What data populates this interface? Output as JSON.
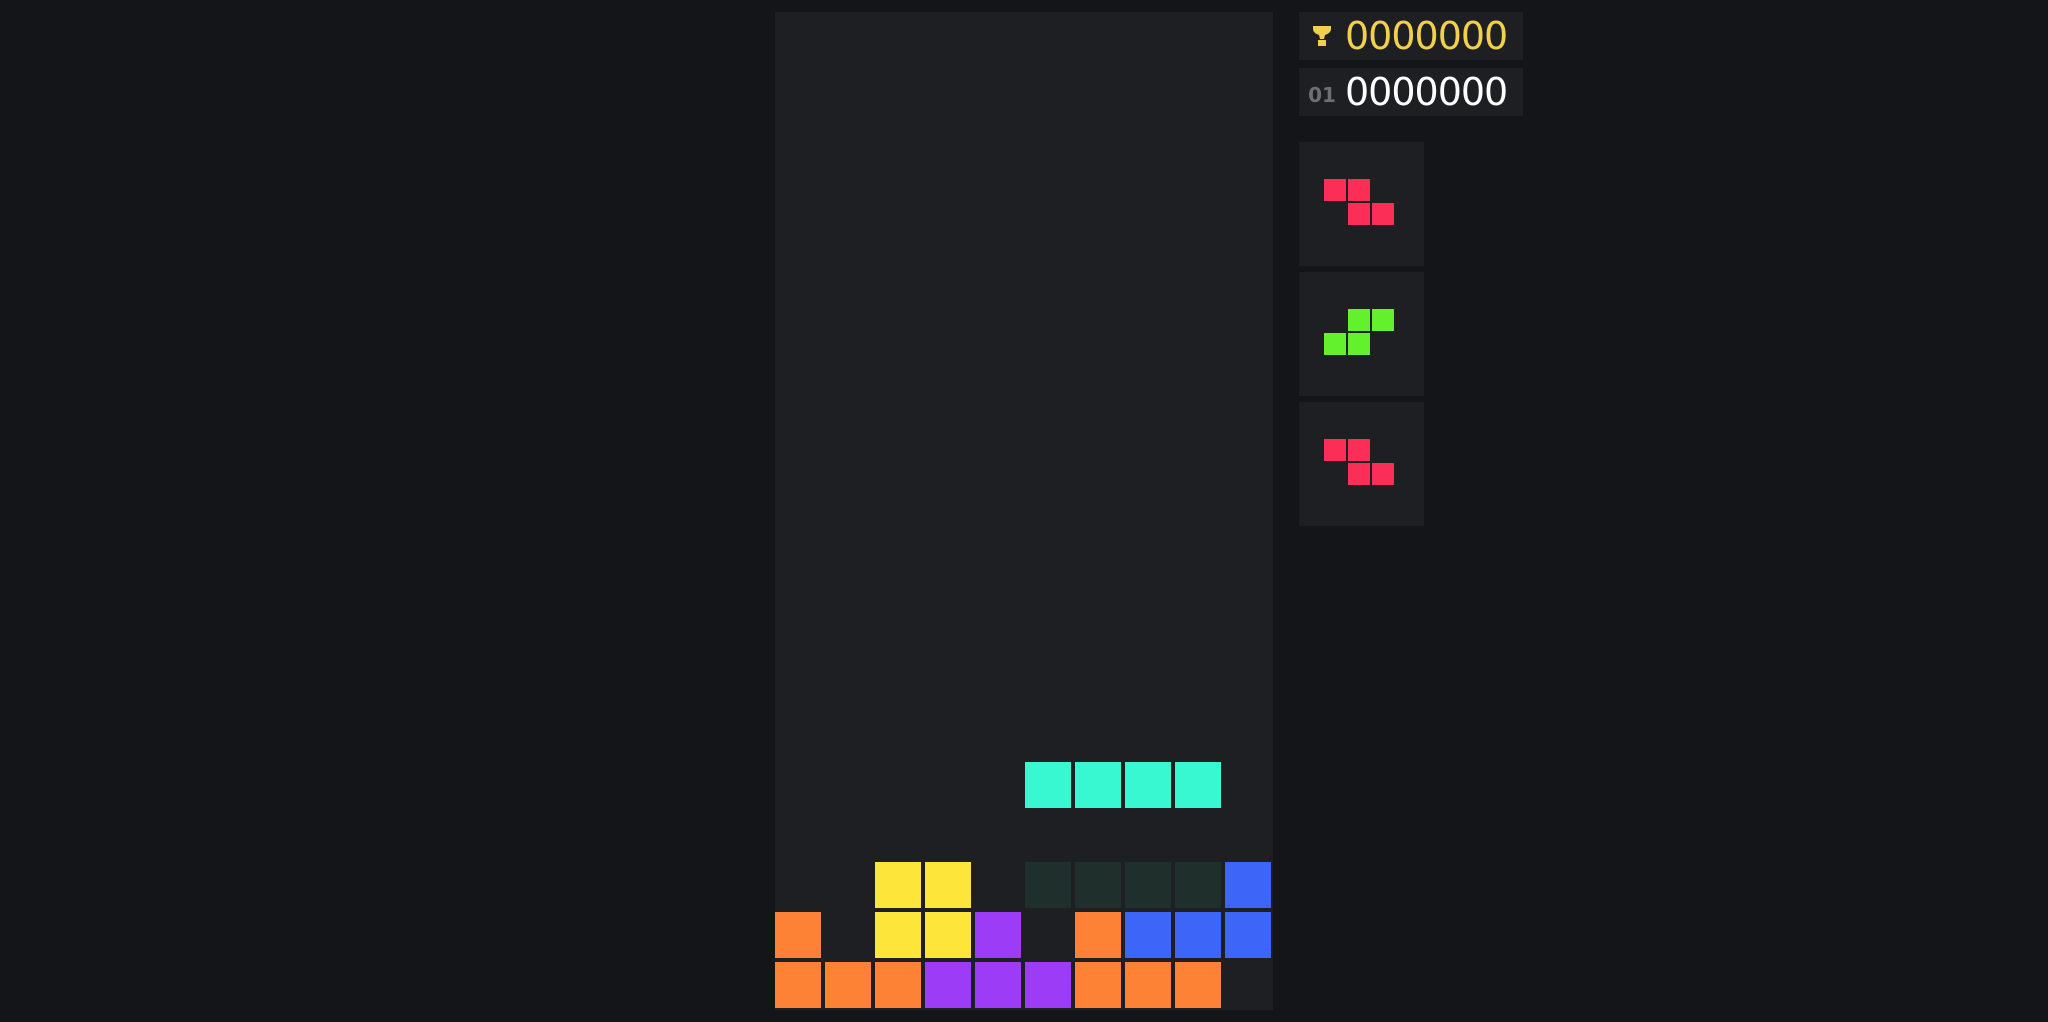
{
  "scores": {
    "best": "0000000",
    "current": "0000000",
    "level": "01"
  },
  "icons": {
    "best": "trophy-icon"
  },
  "colors": {
    "background": "#131519",
    "board": "#1d1f23",
    "ghost": "#1f2f2c",
    "best_score": "#f3d04c",
    "current_score": "#ffffff",
    "level_label": "#6c6f75",
    "I": "#38f8d1",
    "O": "#fde53a",
    "T": "#9d3cf7",
    "L": "#fd8236",
    "J": "#3d66f8",
    "S": "#63f12d",
    "Z": "#fa2e56"
  },
  "board": {
    "columns": 10,
    "rows": 20,
    "locked": [
      {
        "row": 17,
        "col": 2,
        "piece": "O"
      },
      {
        "row": 17,
        "col": 3,
        "piece": "O"
      },
      {
        "row": 17,
        "col": 9,
        "piece": "J"
      },
      {
        "row": 18,
        "col": 0,
        "piece": "L"
      },
      {
        "row": 18,
        "col": 2,
        "piece": "O"
      },
      {
        "row": 18,
        "col": 3,
        "piece": "O"
      },
      {
        "row": 18,
        "col": 4,
        "piece": "T"
      },
      {
        "row": 18,
        "col": 6,
        "piece": "L"
      },
      {
        "row": 18,
        "col": 7,
        "piece": "J"
      },
      {
        "row": 18,
        "col": 8,
        "piece": "J"
      },
      {
        "row": 18,
        "col": 9,
        "piece": "J"
      },
      {
        "row": 19,
        "col": 0,
        "piece": "L"
      },
      {
        "row": 19,
        "col": 1,
        "piece": "L"
      },
      {
        "row": 19,
        "col": 2,
        "piece": "L"
      },
      {
        "row": 19,
        "col": 3,
        "piece": "T"
      },
      {
        "row": 19,
        "col": 4,
        "piece": "T"
      },
      {
        "row": 19,
        "col": 5,
        "piece": "T"
      },
      {
        "row": 19,
        "col": 6,
        "piece": "L"
      },
      {
        "row": 19,
        "col": 7,
        "piece": "L"
      },
      {
        "row": 19,
        "col": 8,
        "piece": "L"
      }
    ],
    "active": {
      "piece": "I",
      "cells": [
        {
          "row": 15,
          "col": 5
        },
        {
          "row": 15,
          "col": 6
        },
        {
          "row": 15,
          "col": 7
        },
        {
          "row": 15,
          "col": 8
        }
      ]
    },
    "ghost": {
      "cells": [
        {
          "row": 17,
          "col": 5
        },
        {
          "row": 17,
          "col": 6
        },
        {
          "row": 17,
          "col": 7
        },
        {
          "row": 17,
          "col": 8
        }
      ]
    }
  },
  "next_queue": [
    {
      "piece": "Z",
      "cells": [
        [
          0,
          0
        ],
        [
          0,
          1
        ],
        [
          1,
          1
        ],
        [
          1,
          2
        ]
      ]
    },
    {
      "piece": "S",
      "cells": [
        [
          0,
          1
        ],
        [
          0,
          2
        ],
        [
          1,
          0
        ],
        [
          1,
          1
        ]
      ]
    },
    {
      "piece": "Z",
      "cells": [
        [
          0,
          0
        ],
        [
          0,
          1
        ],
        [
          1,
          1
        ],
        [
          1,
          2
        ]
      ]
    }
  ]
}
